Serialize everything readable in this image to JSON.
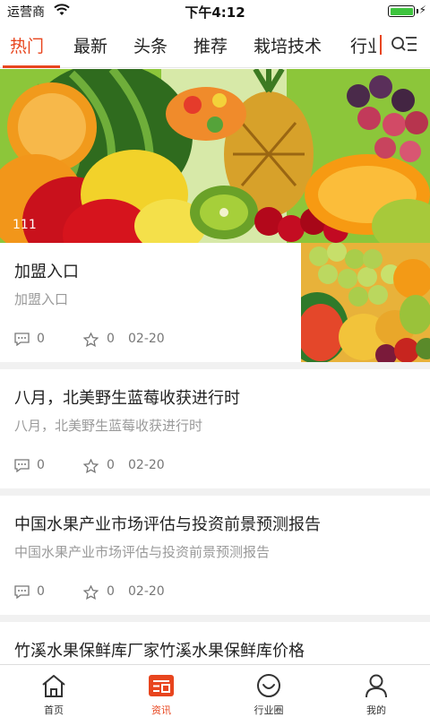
{
  "status_bar": {
    "carrier": "运营商",
    "time": "下午4:12",
    "battery_level": 1.0,
    "battery_color": "#3ec43e"
  },
  "tabs": {
    "items": [
      "热门",
      "最新",
      "头条",
      "推荐",
      "栽培技术",
      "行业"
    ],
    "active_index": 0,
    "accent_color": "#e8451e",
    "menu_icon": "search-list-icon"
  },
  "banner": {
    "caption": "111"
  },
  "articles": [
    {
      "title": "加盟入口",
      "summary": "加盟入口",
      "comments": "0",
      "favorites": "0",
      "date": "02-20",
      "has_thumbnail": true
    },
    {
      "title": "八月，北美野生蓝莓收获进行时",
      "summary": "八月，北美野生蓝莓收获进行时",
      "comments": "0",
      "favorites": "0",
      "date": "02-20",
      "has_thumbnail": false
    },
    {
      "title": "中国水果产业市场评估与投资前景预测报告",
      "summary": "中国水果产业市场评估与投资前景预测报告",
      "comments": "0",
      "favorites": "0",
      "date": "02-20",
      "has_thumbnail": false
    },
    {
      "title": "竹溪水果保鲜库厂家竹溪水果保鲜库价格",
      "has_thumbnail": false
    }
  ],
  "bottom_nav": {
    "items": [
      {
        "label": "首页",
        "icon": "home-icon"
      },
      {
        "label": "资讯",
        "icon": "news-icon"
      },
      {
        "label": "行业圈",
        "icon": "smile-circle-icon"
      },
      {
        "label": "我的",
        "icon": "person-icon"
      }
    ],
    "active_index": 1,
    "active_color": "#e8451e"
  }
}
